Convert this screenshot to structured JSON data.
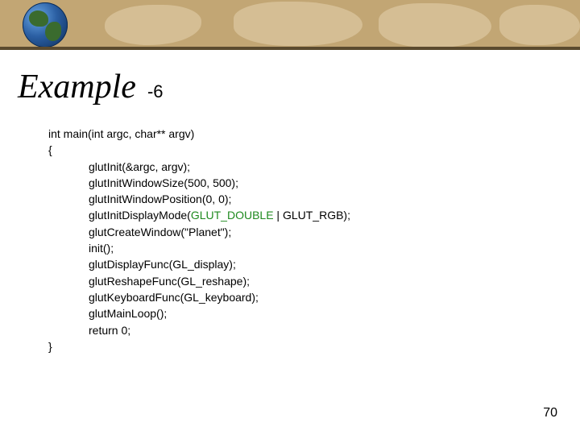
{
  "title": "Example",
  "title_suffix": "-6",
  "code": {
    "l0": "int main(int argc, char** argv)",
    "l1": "{",
    "l2": "glutInit(&argc, argv);",
    "l3": "glutInitWindowSize(500, 500);",
    "l4": "glutInitWindowPosition(0, 0);",
    "l5a": "glutInitDisplayMode(",
    "l5b": "GLUT_DOUBLE",
    "l5c": " | GLUT_RGB);",
    "l6": "glutCreateWindow(\"Planet\");",
    "l7": "init();",
    "l8": "glutDisplayFunc(GL_display);",
    "l9": "glutReshapeFunc(GL_reshape);",
    "l10": "glutKeyboardFunc(GL_keyboard);",
    "l11": "glutMainLoop();",
    "l12": "return 0;",
    "l13": "}"
  },
  "page_number": "70"
}
